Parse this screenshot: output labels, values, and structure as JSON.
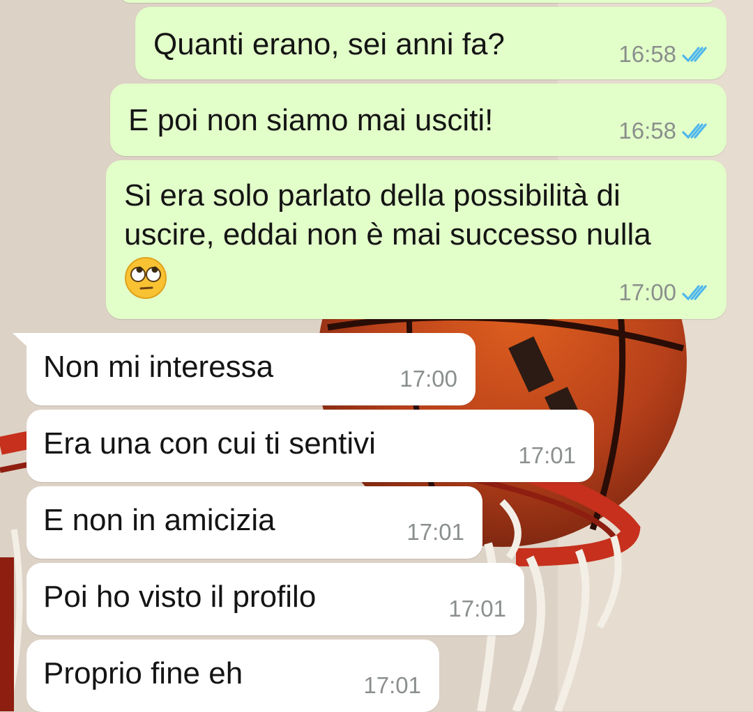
{
  "chat": {
    "colors": {
      "outgoing_bubble": "#e2ffc9",
      "incoming_bubble": "#ffffff",
      "read_tick": "#4fb6ec",
      "timestamp": "#8a8f8c"
    },
    "messages": [
      {
        "direction": "outgoing",
        "text": "Quanti erano, sei anni fa?",
        "time": "16:58",
        "status": "read"
      },
      {
        "direction": "outgoing",
        "text": "E poi non siamo mai usciti!",
        "time": "16:58",
        "status": "read"
      },
      {
        "direction": "outgoing",
        "text_line1": "Si era solo parlato della possibilità di",
        "text_line2": "uscire, eddai non è mai successo nulla",
        "emoji": "face-with-rolling-eyes",
        "time": "17:00",
        "status": "read"
      },
      {
        "direction": "incoming",
        "text": "Non mi interessa",
        "time": "17:00"
      },
      {
        "direction": "incoming",
        "text": "Era una con cui ti sentivi",
        "time": "17:01"
      },
      {
        "direction": "incoming",
        "text": "E non in amicizia",
        "time": "17:01"
      },
      {
        "direction": "incoming",
        "text": "Poi ho visto il profilo",
        "time": "17:01"
      },
      {
        "direction": "incoming",
        "text": "Proprio fine eh",
        "time": "17:01"
      }
    ]
  }
}
